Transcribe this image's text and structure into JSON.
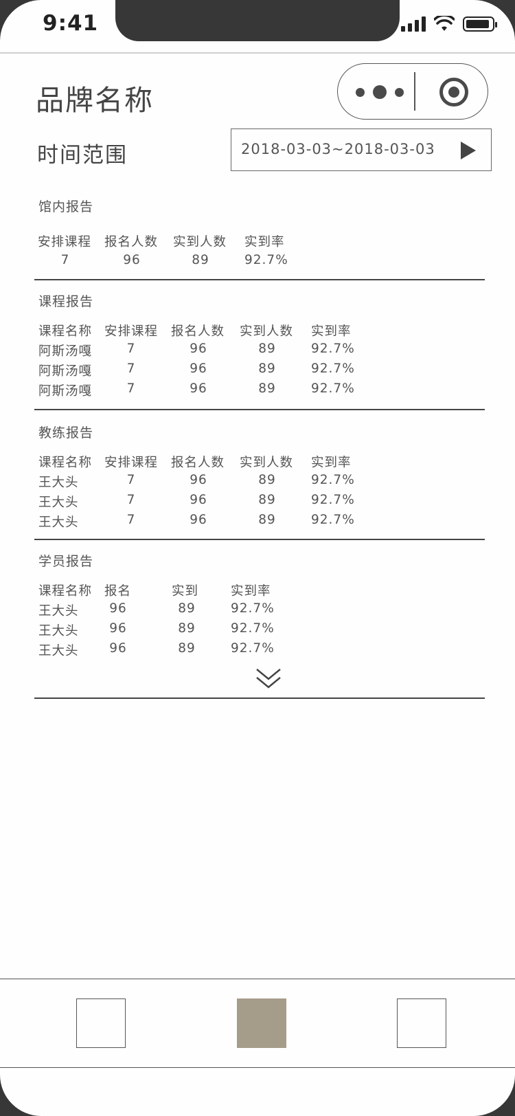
{
  "status_bar": {
    "time": "9:41"
  },
  "header": {
    "brand": "品牌名称",
    "range_label": "时间范围",
    "date_range": "2018-03-03~2018-03-03"
  },
  "sections": {
    "venue": {
      "title": "馆内报告",
      "headers": [
        "安排课程",
        "报名人数",
        "实到人数",
        "实到率"
      ],
      "row": [
        "7",
        "96",
        "89",
        "92.7%"
      ]
    },
    "course": {
      "title": "课程报告",
      "headers": [
        "课程名称",
        "安排课程",
        "报名人数",
        "实到人数",
        "实到率"
      ],
      "rows": [
        [
          "阿斯汤嘎",
          "7",
          "96",
          "89",
          "92.7%"
        ],
        [
          "阿斯汤嘎",
          "7",
          "96",
          "89",
          "92.7%"
        ],
        [
          "阿斯汤嘎",
          "7",
          "96",
          "89",
          "92.7%"
        ]
      ]
    },
    "coach": {
      "title": "教练报告",
      "headers": [
        "课程名称",
        "安排课程",
        "报名人数",
        "实到人数",
        "实到率"
      ],
      "rows": [
        [
          "王大头",
          "7",
          "96",
          "89",
          "92.7%"
        ],
        [
          "王大头",
          "7",
          "96",
          "89",
          "92.7%"
        ],
        [
          "王大头",
          "7",
          "96",
          "89",
          "92.7%"
        ]
      ]
    },
    "student": {
      "title": "学员报告",
      "headers": [
        "课程名称",
        "报名",
        "实到",
        "实到率"
      ],
      "rows": [
        [
          "王大头",
          "96",
          "89",
          "92.7%"
        ],
        [
          "王大头",
          "96",
          "89",
          "92.7%"
        ],
        [
          "王大头",
          "96",
          "89",
          "92.7%"
        ]
      ]
    }
  },
  "tabbar": {
    "active_index": 1,
    "active_color": "#a59c8a"
  },
  "colors": {
    "text": "#4a4a4a",
    "notch": "#373737"
  }
}
